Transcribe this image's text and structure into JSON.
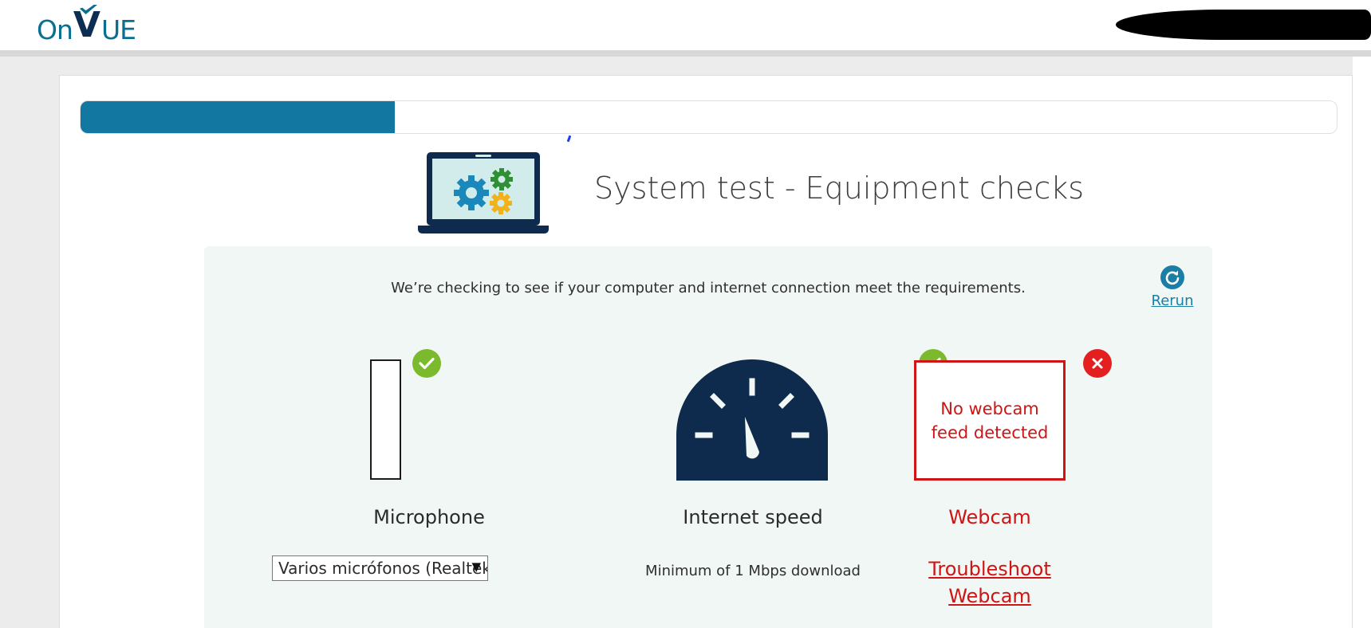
{
  "header": {
    "logo_on": "On",
    "logo_v": "V",
    "logo_ue": "UE"
  },
  "progress": {
    "fraction": 0.25
  },
  "page": {
    "title": "System test - Equipment checks"
  },
  "panel": {
    "intro": "We’re checking to see if your computer and internet connection meet the requirements.",
    "rerun_label": "Rerun"
  },
  "checks": {
    "microphone": {
      "label": "Microphone",
      "status": "pass",
      "selected_device": "Varios micrófonos (Realtek(R) Audio)"
    },
    "internet": {
      "label": "Internet speed",
      "status": "pass",
      "requirement": "Minimum of 1 Mbps download"
    },
    "webcam": {
      "label": "Webcam",
      "status": "fail",
      "feed_message_line1": "No webcam",
      "feed_message_line2": "feed detected",
      "troubleshoot_line1": "Troubleshoot",
      "troubleshoot_line2": "Webcam"
    }
  },
  "colors": {
    "brand": "#1378a1",
    "navy": "#0e2a4c",
    "success": "#7aba2c",
    "error": "#d01414",
    "panel_bg": "#f1f7f5"
  },
  "icons": {
    "title": "laptop-gears-icon",
    "rerun": "refresh-icon",
    "pass": "checkmark-icon",
    "fail": "x-icon",
    "speed": "speedometer-icon"
  }
}
